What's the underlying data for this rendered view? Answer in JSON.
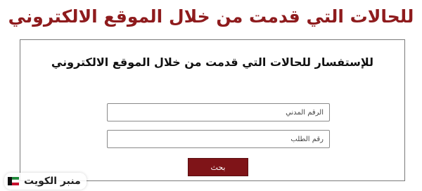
{
  "header": {
    "title": "للحالات التي قدمت من خلال الموقع الالكتروني"
  },
  "form": {
    "title": "للإستفسار للحالات التي قدمت من خلال الموقع الالكتروني",
    "civil_id_placeholder": "الرقم المدني",
    "request_number_placeholder": "رقم الطلب",
    "search_button_label": "بحث"
  },
  "watermark": {
    "text": "منبر الكويت",
    "logo_icon": "kuwait-flag-logo-icon"
  },
  "colors": {
    "accent": "#8e1b1d",
    "button_background": "#7f1418",
    "border": "#7a7a7a"
  }
}
